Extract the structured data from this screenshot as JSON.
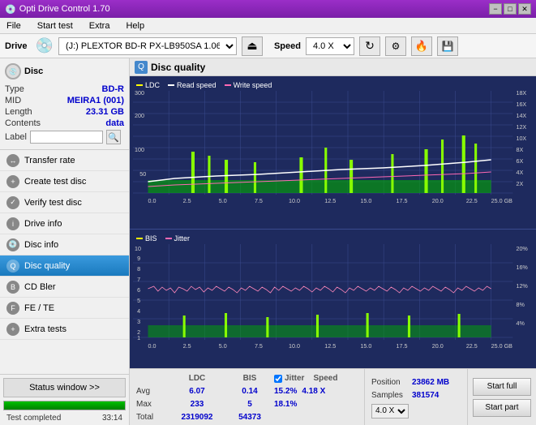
{
  "titleBar": {
    "title": "Opti Drive Control 1.70",
    "minimize": "−",
    "maximize": "□",
    "close": "✕"
  },
  "menuBar": {
    "items": [
      "File",
      "Start test",
      "Extra",
      "Help"
    ]
  },
  "driveToolbar": {
    "driveLabel": "Drive",
    "driveIcon": "💿",
    "driveValue": "(J:)  PLEXTOR BD-R  PX-LB950SA 1.06",
    "ejectIcon": "⏏",
    "speedLabel": "Speed",
    "speedValue": "4.0 X",
    "icons": [
      "refresh",
      "settings",
      "burn",
      "save"
    ]
  },
  "discPanel": {
    "title": "Disc",
    "rows": [
      {
        "label": "Type",
        "value": "BD-R"
      },
      {
        "label": "MID",
        "value": "MEIRA1 (001)"
      },
      {
        "label": "Length",
        "value": "23.31 GB"
      },
      {
        "label": "Contents",
        "value": "data"
      },
      {
        "label": "Label",
        "value": ""
      }
    ]
  },
  "navItems": [
    {
      "label": "Transfer rate",
      "active": false
    },
    {
      "label": "Create test disc",
      "active": false
    },
    {
      "label": "Verify test disc",
      "active": false
    },
    {
      "label": "Drive info",
      "active": false
    },
    {
      "label": "Disc info",
      "active": false
    },
    {
      "label": "Disc quality",
      "active": true
    },
    {
      "label": "CD Bler",
      "active": false
    },
    {
      "label": "FE / TE",
      "active": false
    },
    {
      "label": "Extra tests",
      "active": false
    }
  ],
  "statusBtn": "Status window >>",
  "progressValue": 100,
  "statusText": "Test completed",
  "timeText": "33:14",
  "qualityHeader": "Disc quality",
  "chart1": {
    "legend": [
      {
        "label": "LDC",
        "color": "#ffff00"
      },
      {
        "label": "Read speed",
        "color": "#ffffff"
      },
      {
        "label": "Write speed",
        "color": "#ff69b4"
      }
    ],
    "yAxisMax": 300,
    "yAxisRightLabels": [
      "18X",
      "16X",
      "14X",
      "12X",
      "10X",
      "8X",
      "6X",
      "4X",
      "2X"
    ],
    "xAxisLabels": [
      "0.0",
      "2.5",
      "5.0",
      "7.5",
      "10.0",
      "12.5",
      "15.0",
      "17.5",
      "20.0",
      "22.5",
      "25.0 GB"
    ]
  },
  "chart2": {
    "legend": [
      {
        "label": "BIS",
        "color": "#ffff00"
      },
      {
        "label": "Jitter",
        "color": "#ff69b4"
      }
    ],
    "yAxisMax": 10,
    "yAxisRightLabels": [
      "20%",
      "16%",
      "12%",
      "8%",
      "4%"
    ],
    "xAxisLabels": [
      "0.0",
      "2.5",
      "5.0",
      "7.5",
      "10.0",
      "12.5",
      "15.0",
      "17.5",
      "20.0",
      "22.5",
      "25.0 GB"
    ]
  },
  "stats": {
    "headers": [
      "",
      "LDC",
      "BIS",
      "",
      "Jitter",
      "Speed"
    ],
    "rows": [
      {
        "label": "Avg",
        "ldc": "6.07",
        "bis": "0.14",
        "jitter": "15.2%",
        "speed": "4.18 X"
      },
      {
        "label": "Max",
        "ldc": "233",
        "bis": "5",
        "jitter": "18.1%",
        "speed": ""
      },
      {
        "label": "Total",
        "ldc": "2319092",
        "bis": "54373",
        "jitter": "",
        "speed": ""
      }
    ],
    "speedTarget": "4.0 X",
    "position": "23862 MB",
    "samples": "381574",
    "jitterChecked": true
  },
  "buttons": {
    "startFull": "Start full",
    "startPart": "Start part"
  }
}
